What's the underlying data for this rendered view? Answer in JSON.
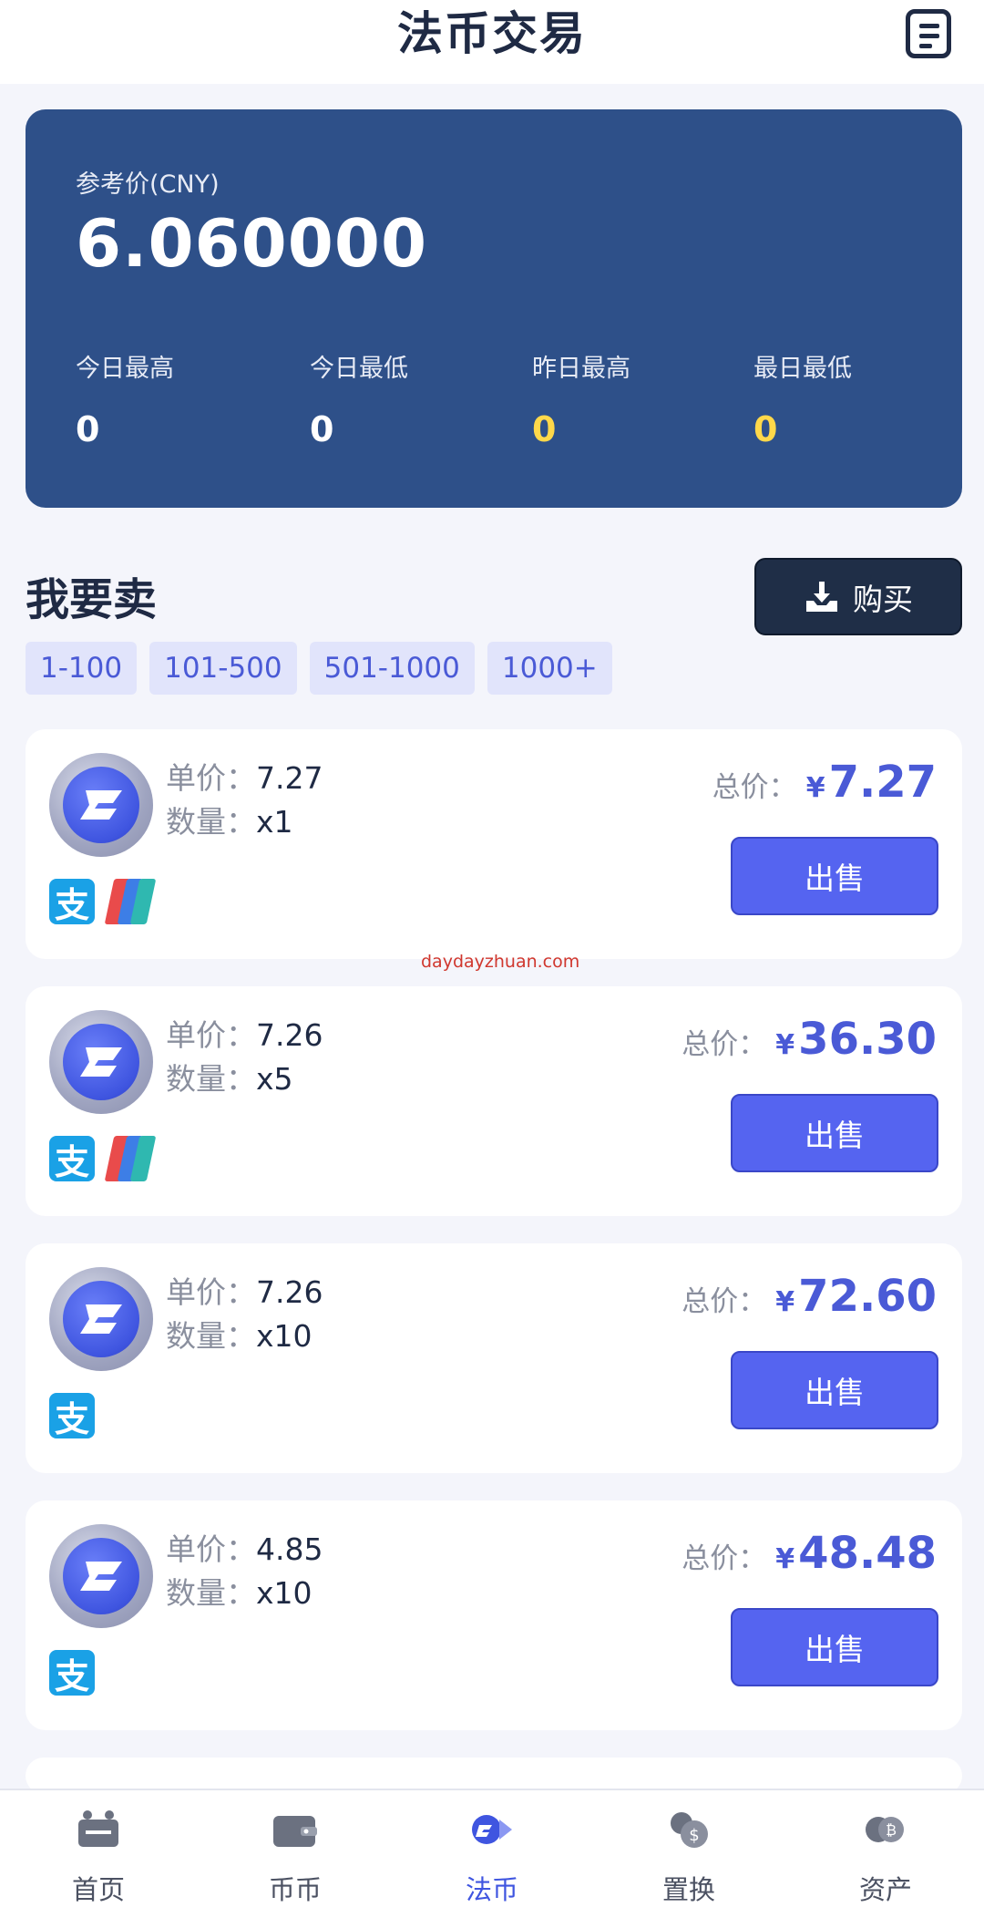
{
  "header": {
    "title": "法币交易",
    "menu_icon": "document-list-icon"
  },
  "price_card": {
    "ref_label": "参考价(CNY)",
    "ref_price": "6.060000",
    "stats": [
      {
        "label": "今日最高",
        "value": "0",
        "highlight": false
      },
      {
        "label": "今日最低",
        "value": "0",
        "highlight": false
      },
      {
        "label": "昨日最高",
        "value": "0",
        "highlight": true
      },
      {
        "label": "最日最低",
        "value": "0",
        "highlight": true
      }
    ]
  },
  "section": {
    "title": "我要卖",
    "buy_button": "购买",
    "filters": [
      "1-100",
      "101-500",
      "501-1000",
      "1000+"
    ]
  },
  "listings": [
    {
      "unit_price_label": "单价：",
      "unit_price": "7.27",
      "qty_label": "数量：",
      "qty": "x1",
      "total_label": "总价：",
      "currency": "¥",
      "total": "7.27",
      "sell_label": "出售",
      "payments": [
        "alipay",
        "unionpay"
      ]
    },
    {
      "unit_price_label": "单价：",
      "unit_price": "7.26",
      "qty_label": "数量：",
      "qty": "x5",
      "total_label": "总价：",
      "currency": "¥",
      "total": "36.30",
      "sell_label": "出售",
      "payments": [
        "alipay",
        "unionpay"
      ]
    },
    {
      "unit_price_label": "单价：",
      "unit_price": "7.26",
      "qty_label": "数量：",
      "qty": "x10",
      "total_label": "总价：",
      "currency": "¥",
      "total": "72.60",
      "sell_label": "出售",
      "payments": [
        "alipay"
      ]
    },
    {
      "unit_price_label": "单价：",
      "unit_price": "4.85",
      "qty_label": "数量：",
      "qty": "x10",
      "total_label": "总价：",
      "currency": "¥",
      "total": "48.48",
      "sell_label": "出售",
      "payments": [
        "alipay"
      ]
    }
  ],
  "watermark": "daydayzhuan.com",
  "nav": [
    {
      "label": "首页",
      "icon": "home-icon",
      "active": false
    },
    {
      "label": "币币",
      "icon": "wallet-icon",
      "active": false
    },
    {
      "label": "法币",
      "icon": "fiat-exchange-icon",
      "active": true
    },
    {
      "label": "置换",
      "icon": "swap-icon",
      "active": false
    },
    {
      "label": "资产",
      "icon": "assets-icon",
      "active": false
    }
  ],
  "colors": {
    "accent": "#5564f0",
    "card_blue": "#2e5089",
    "highlight_yellow": "#ffd84a"
  }
}
